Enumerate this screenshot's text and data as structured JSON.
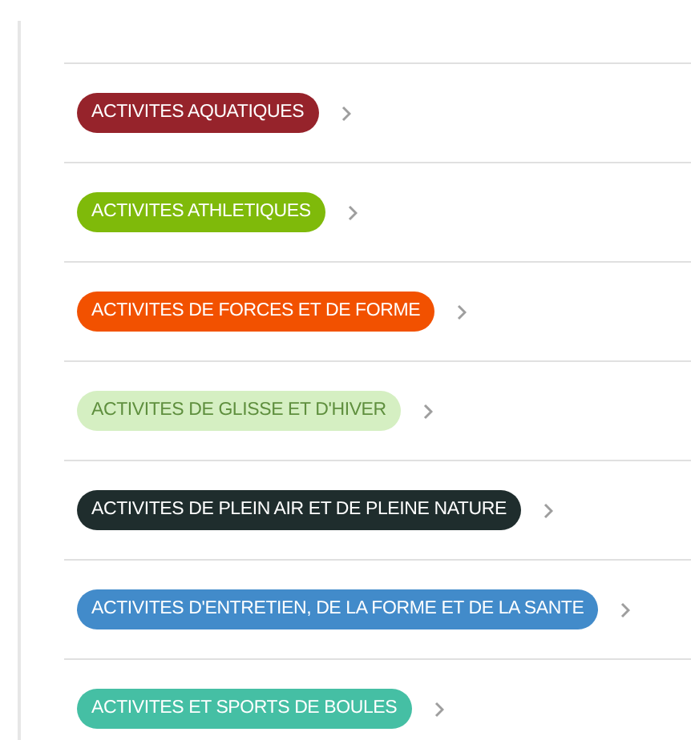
{
  "categories": [
    {
      "label": "ACTIVITES AQUATIQUES",
      "color": "#96232b"
    },
    {
      "label": "ACTIVITES ATHLETIQUES",
      "color": "#7fba0a"
    },
    {
      "label": "ACTIVITES DE FORCES ET DE FORME",
      "color": "#f25100"
    },
    {
      "label": "ACTIVITES DE GLISSE ET D'HIVER",
      "color": "#d5efc2"
    },
    {
      "label": "ACTIVITES DE PLEIN AIR ET DE PLEINE NATURE",
      "color": "#1f2d2d"
    },
    {
      "label": "ACTIVITES D'ENTRETIEN, DE LA FORME ET DE LA SANTE",
      "color": "#428bca"
    },
    {
      "label": "ACTIVITES ET SPORTS DE BOULES",
      "color": "#45bfa4"
    }
  ]
}
